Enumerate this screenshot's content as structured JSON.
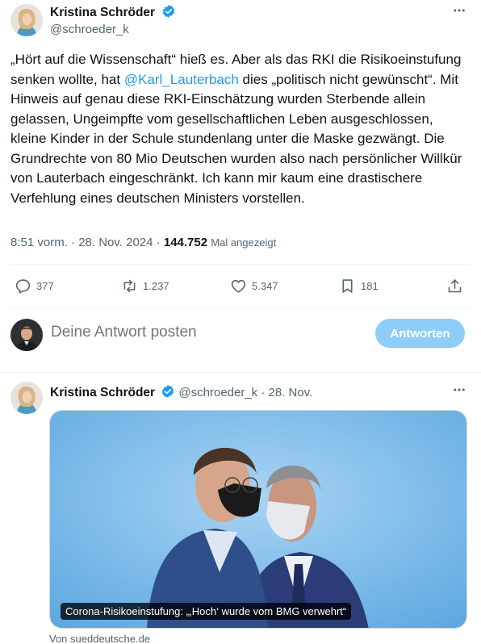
{
  "main_tweet": {
    "author_name": "Kristina Schröder",
    "handle": "@schroeder_k",
    "more_icon": "more-horizontal-icon",
    "text_parts": {
      "before_mention": "„Hört auf die Wissenschaft“ hieß es. Aber als das RKI die Risikoeinstufung senken wollte, hat ",
      "mention": "@Karl_Lauterbach",
      "after_mention": " dies „politisch nicht gewünscht“. Mit Hinweis auf genau diese RKI-Einschätzung wurden Sterbende allein gelassen, Ungeimpfte vom gesellschaftlichen Leben ausgeschlossen, kleine Kinder in der Schule stundenlang unter die Maske gezwängt. Die Grundrechte von 80 Mio Deutschen wurden also nach persönlicher Willkür von Lauterbach eingeschränkt. Ich kann mir kaum eine drastischere Verfehlung eines deutschen Ministers vorstellen."
    },
    "time": "8:51 vorm.",
    "date": "28. Nov. 2024",
    "views_count": "144.752",
    "views_label": "Mal angezeigt"
  },
  "actions": {
    "replies": "377",
    "reposts": "1.237",
    "likes": "5.347",
    "bookmarks": "181"
  },
  "reply_box": {
    "placeholder": "Deine Antwort posten",
    "button_label": "Antworten"
  },
  "quoted_tweet": {
    "author_name": "Kristina Schröder",
    "handle": "@schroeder_k",
    "date": "28. Nov.",
    "card_title": "Corona-Risikoeinstufung: „‚Hoch‘ wurde vom BMG verwehrt“",
    "card_source": "Von sueddeutsche.de"
  },
  "colors": {
    "accent": "#1d9bf0",
    "verified": "#1d9bf0",
    "button_disabled": "#8ecdf8",
    "secondary_text": "#536471"
  }
}
